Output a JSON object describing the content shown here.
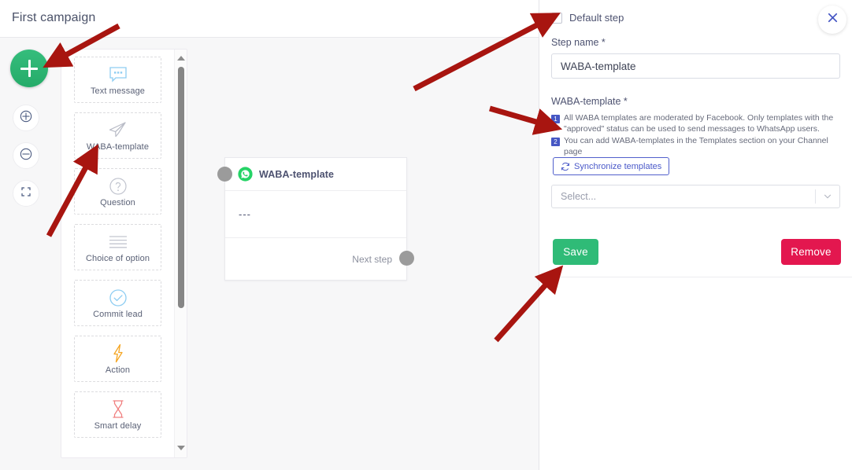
{
  "header": {
    "title": "First campaign"
  },
  "canvas_controls": {
    "add_button": "add-step",
    "zoom_in": "zoom-in",
    "zoom_out": "zoom-out",
    "fit_screen": "fit-to-screen"
  },
  "palette": {
    "items": [
      {
        "label": "Text message",
        "icon": "speech-bubble-icon"
      },
      {
        "label": "WABA-template",
        "icon": "paper-plane-icon"
      },
      {
        "label": "Question",
        "icon": "question-circle-icon"
      },
      {
        "label": "Choice of option",
        "icon": "list-lines-icon"
      },
      {
        "label": "Commit lead",
        "icon": "check-circle-icon"
      },
      {
        "label": "Action",
        "icon": "lightning-bolt-icon"
      },
      {
        "label": "Smart delay",
        "icon": "hourglass-icon"
      }
    ]
  },
  "node": {
    "title": "WABA-template",
    "body_text": "---",
    "next_step_label": "Next step",
    "channel_icon": "whatsapp-icon"
  },
  "panel": {
    "default_step_label": "Default step",
    "default_step_checked": false,
    "step_name_label": "Step name *",
    "step_name_value": "WABA-template",
    "step_name_placeholder": "Step name",
    "waba_label": "WABA-template *",
    "notes": [
      {
        "badge": "1",
        "text": "All WABA templates are moderated by Facebook. Only templates with the \"approved\" status can be used to send messages to WhatsApp users."
      },
      {
        "badge": "2",
        "text": "You can add WABA-templates in the Templates section on your Channel page"
      }
    ],
    "sync_button_label": "Synchronize templates",
    "sync_button_icon": "refresh-icon",
    "select_placeholder": "Select...",
    "save_label": "Save",
    "remove_label": "Remove",
    "close_icon": "close-icon"
  },
  "colors": {
    "accent_green": "#2fbb73",
    "danger_red": "#e3174f",
    "link_blue": "#4a59c9",
    "annotation_red": "#a81510",
    "whatsapp_green": "#25d366",
    "icon_blue": "#8ecdf2",
    "icon_orange": "#f5a623",
    "icon_pink": "#f08080"
  }
}
